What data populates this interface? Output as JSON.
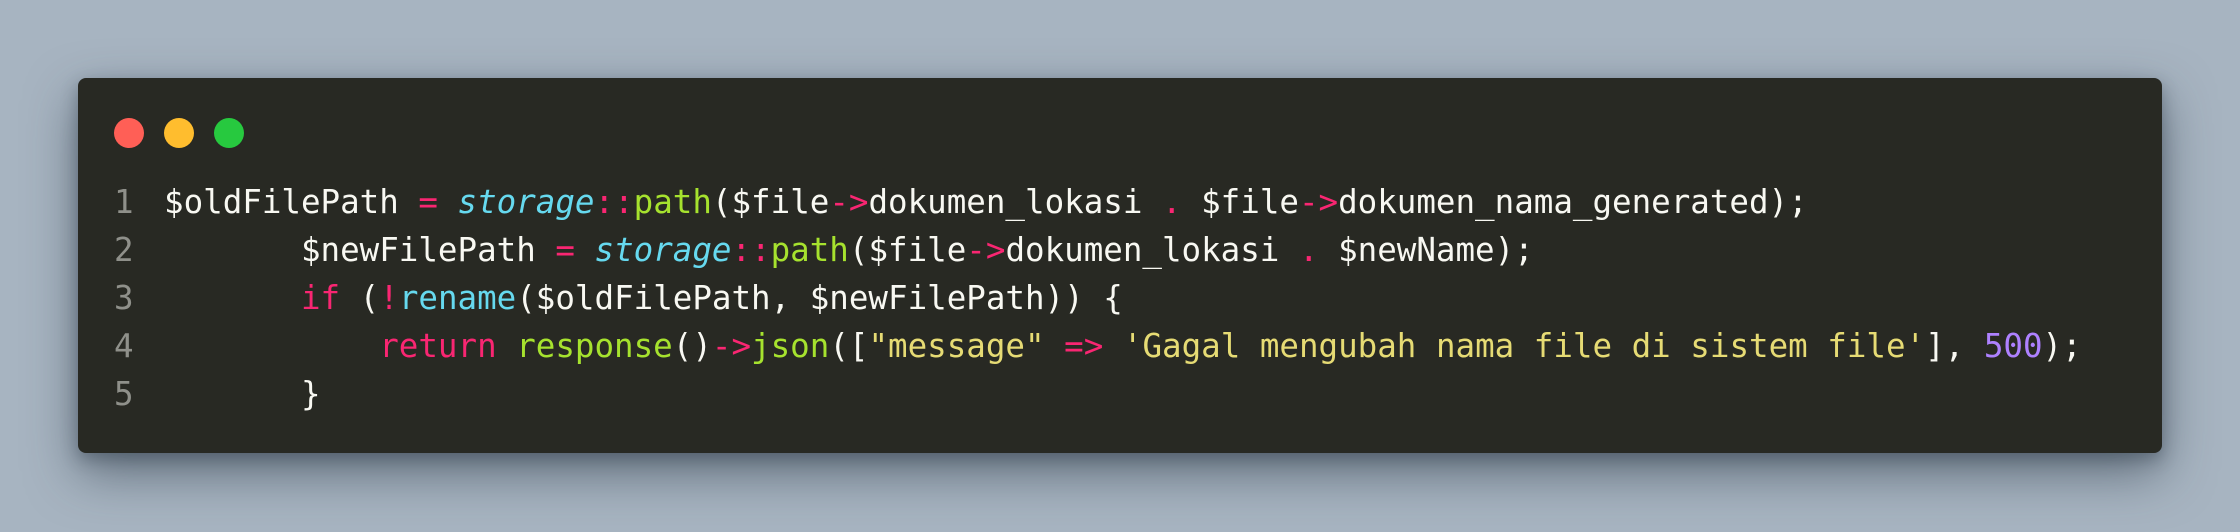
{
  "window": {
    "controls": [
      "close",
      "minimize",
      "maximize"
    ]
  },
  "colors": {
    "background": "#a7b4c1",
    "editor": "#282923",
    "close": "#ff5f56",
    "minimize": "#ffbd2e",
    "maximize": "#27c93f"
  },
  "code": {
    "lines": [
      {
        "number": "1",
        "tokens": [
          {
            "text": "$oldFilePath ",
            "type": "var"
          },
          {
            "text": "=",
            "type": "op"
          },
          {
            "text": " ",
            "type": "punc"
          },
          {
            "text": "storage",
            "type": "cls"
          },
          {
            "text": "::",
            "type": "op"
          },
          {
            "text": "path",
            "type": "fn"
          },
          {
            "text": "($file",
            "type": "var"
          },
          {
            "text": "->",
            "type": "op"
          },
          {
            "text": "dokumen_lokasi ",
            "type": "var"
          },
          {
            "text": ".",
            "type": "op"
          },
          {
            "text": " $file",
            "type": "var"
          },
          {
            "text": "->",
            "type": "op"
          },
          {
            "text": "dokumen_nama_generated);",
            "type": "var"
          }
        ]
      },
      {
        "number": "2",
        "tokens": [
          {
            "text": "       $newFilePath ",
            "type": "var"
          },
          {
            "text": "=",
            "type": "op"
          },
          {
            "text": " ",
            "type": "punc"
          },
          {
            "text": "storage",
            "type": "cls"
          },
          {
            "text": "::",
            "type": "op"
          },
          {
            "text": "path",
            "type": "fn"
          },
          {
            "text": "($file",
            "type": "var"
          },
          {
            "text": "->",
            "type": "op"
          },
          {
            "text": "dokumen_lokasi ",
            "type": "var"
          },
          {
            "text": ".",
            "type": "op"
          },
          {
            "text": " $newName);",
            "type": "var"
          }
        ]
      },
      {
        "number": "3",
        "tokens": [
          {
            "text": "       ",
            "type": "punc"
          },
          {
            "text": "if",
            "type": "kw"
          },
          {
            "text": " (",
            "type": "punc"
          },
          {
            "text": "!",
            "type": "op"
          },
          {
            "text": "rename",
            "type": "call"
          },
          {
            "text": "($oldFilePath, $newFilePath)) {",
            "type": "var"
          }
        ]
      },
      {
        "number": "4",
        "tokens": [
          {
            "text": "           ",
            "type": "punc"
          },
          {
            "text": "return",
            "type": "kw"
          },
          {
            "text": " ",
            "type": "punc"
          },
          {
            "text": "response",
            "type": "fn"
          },
          {
            "text": "()",
            "type": "punc"
          },
          {
            "text": "->",
            "type": "op"
          },
          {
            "text": "json",
            "type": "fn"
          },
          {
            "text": "([",
            "type": "punc"
          },
          {
            "text": "\"message\"",
            "type": "str"
          },
          {
            "text": " ",
            "type": "punc"
          },
          {
            "text": "=>",
            "type": "op"
          },
          {
            "text": " ",
            "type": "punc"
          },
          {
            "text": "'Gagal mengubah nama file di sistem file'",
            "type": "str"
          },
          {
            "text": "], ",
            "type": "punc"
          },
          {
            "text": "500",
            "type": "num"
          },
          {
            "text": ");",
            "type": "punc"
          }
        ]
      },
      {
        "number": "5",
        "tokens": [
          {
            "text": "       }",
            "type": "punc"
          }
        ]
      }
    ]
  }
}
